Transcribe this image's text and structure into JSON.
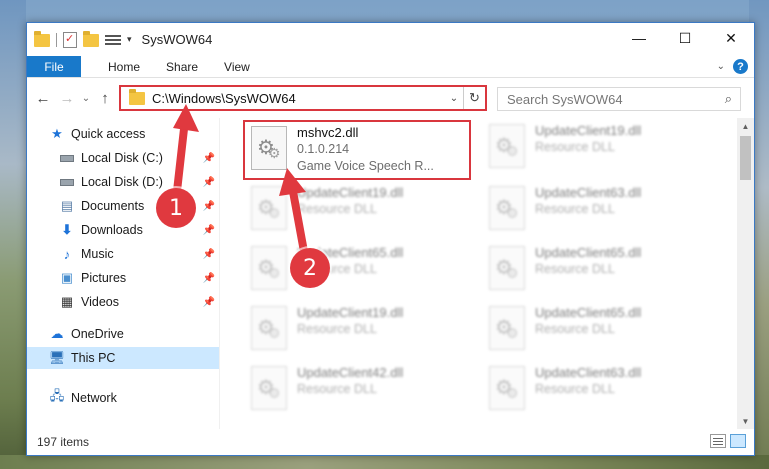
{
  "window": {
    "title": "SysWOW64",
    "controls": {
      "minimize": "—",
      "maximize": "☐",
      "close": "✕"
    }
  },
  "ribbon": {
    "file": "File",
    "tabs": [
      "Home",
      "Share",
      "View"
    ],
    "help": "?"
  },
  "address": {
    "path": "C:\\Windows\\SysWOW64",
    "search_placeholder": "Search SysWOW64"
  },
  "nav": {
    "items": [
      {
        "label": "Quick access",
        "icon": "star-icon",
        "pinned": false
      },
      {
        "label": "Local Disk (C:)",
        "icon": "drive-icon",
        "pinned": true
      },
      {
        "label": "Local Disk (D:)",
        "icon": "drive-icon",
        "pinned": true
      },
      {
        "label": "Documents",
        "icon": "documents-icon",
        "pinned": true
      },
      {
        "label": "Downloads",
        "icon": "download-icon",
        "pinned": true
      },
      {
        "label": "Music",
        "icon": "music-icon",
        "pinned": true
      },
      {
        "label": "Pictures",
        "icon": "pictures-icon",
        "pinned": true
      },
      {
        "label": "Videos",
        "icon": "videos-icon",
        "pinned": true
      },
      {
        "label": "OneDrive",
        "icon": "cloud-icon",
        "pinned": false
      },
      {
        "label": "This PC",
        "icon": "computer-icon",
        "pinned": false,
        "selected": true
      },
      {
        "label": "Network",
        "icon": "network-icon",
        "pinned": false
      }
    ]
  },
  "files": {
    "highlighted": {
      "name": "mshvc2.dll",
      "version": "0.1.0.214",
      "description": "Game Voice Speech R..."
    },
    "blurred": [
      {
        "name": "UpdateClient19.dll",
        "type": "Resource DLL"
      },
      {
        "name": "UpdateClient19.dll",
        "type": "Resource DLL"
      },
      {
        "name": "UpdateClient63.dll",
        "type": "Resource DLL"
      },
      {
        "name": "UpdateClient65.dll",
        "type": "Resource DLL"
      },
      {
        "name": "UpdateClient65.dll",
        "type": "Resource DLL"
      },
      {
        "name": "UpdateClient19.dll",
        "type": "Resource DLL"
      },
      {
        "name": "UpdateClient65.dll",
        "type": "Resource DLL"
      },
      {
        "name": "UpdateClient42.dll",
        "type": "Resource DLL"
      },
      {
        "name": "UpdateClient63.dll",
        "type": "Resource DLL"
      }
    ]
  },
  "status": {
    "item_count": "197 items"
  },
  "annotations": {
    "step1": "1",
    "step2": "2",
    "color": "#e0393f"
  }
}
